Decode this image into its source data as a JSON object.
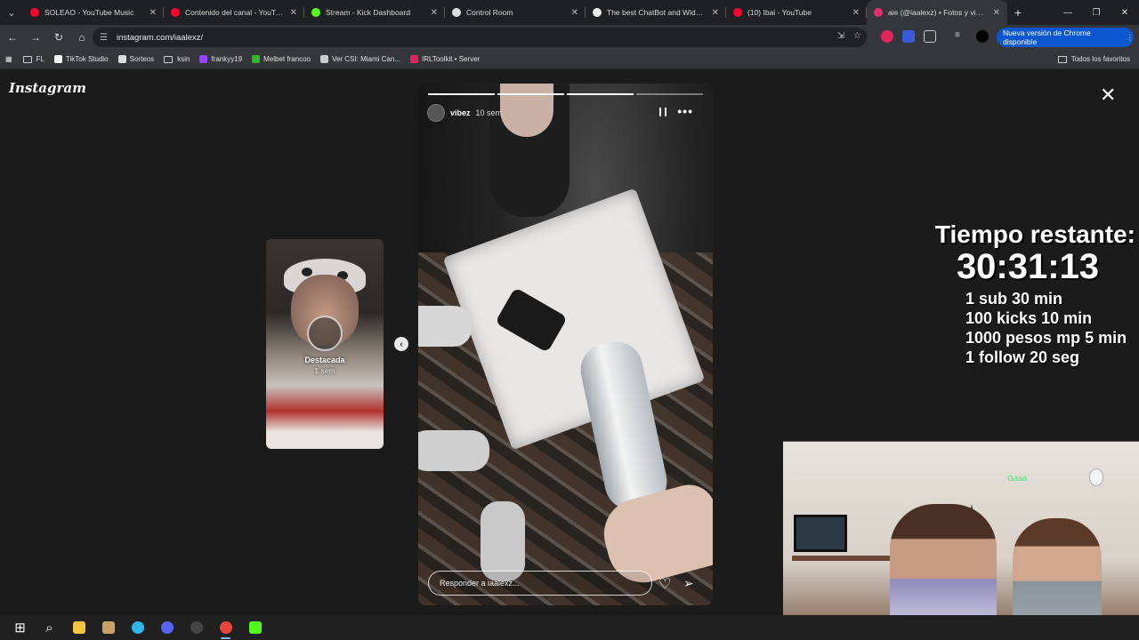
{
  "browser": {
    "tabs": [
      {
        "title": "SOLEAO - YouTube Music",
        "favicon_color": "#ff0033",
        "active": false
      },
      {
        "title": "Contenido del canal - YouTube",
        "favicon_color": "#ff0033",
        "active": false
      },
      {
        "title": "Stream - Kick Dashboard",
        "favicon_color": "#53fc18",
        "active": false
      },
      {
        "title": "Control Room",
        "favicon_color": "#dddddd",
        "active": false
      },
      {
        "title": "The best ChatBot and Widgets",
        "favicon_color": "#eeeeee",
        "active": false
      },
      {
        "title": "(10) Ibai - YouTube",
        "favicon_color": "#ff0033",
        "active": false
      },
      {
        "title": "aie (@iaalexz) • Fotos y videos",
        "favicon_color": "#e1306c",
        "active": true
      }
    ],
    "url": "instagram.com/iaalexz/",
    "update_label": "Nueva versión de Chrome disponible",
    "bookmarks": [
      {
        "label": "FL",
        "icon": "folder-icon"
      },
      {
        "label": "TikTok Studio",
        "icon": "tiktok-icon"
      },
      {
        "label": "Sorteos",
        "icon": "diamond-icon"
      },
      {
        "label": "ksin",
        "icon": "folder-icon"
      },
      {
        "label": "frankyy19",
        "icon": "twitch-icon"
      },
      {
        "label": "Melbet francoo",
        "icon": "melbet-icon"
      },
      {
        "label": "Ver CSI: Miami Can...",
        "icon": "tv-icon"
      },
      {
        "label": "IRLToolkit • Server",
        "icon": "irltoolkit-icon"
      }
    ],
    "bookmarks_right": "Todos los favoritos"
  },
  "instagram": {
    "logo": "Instagram",
    "preview": {
      "label": "Destacada",
      "time": "1 sem"
    },
    "story": {
      "username": "vibez",
      "time": "10 sem",
      "reply_placeholder": "Responder a iaalexz...",
      "segments_total": 4,
      "segments_done": 3
    }
  },
  "overlay": {
    "timer_label": "Tiempo restante:",
    "timer_value": "30:31:13",
    "rules": [
      "1 sub 30 min",
      "100 kicks 10 min",
      "1000 pesos mp 5 min",
      "1 follow 20 seg"
    ],
    "neon_sign": "Gaaa"
  },
  "taskbar": {
    "apps": [
      "windows-start-icon",
      "search-icon",
      "file-explorer-icon",
      "app-icon",
      "edge-icon",
      "discord-icon",
      "obs-icon",
      "chrome-icon",
      "kick-icon"
    ]
  }
}
